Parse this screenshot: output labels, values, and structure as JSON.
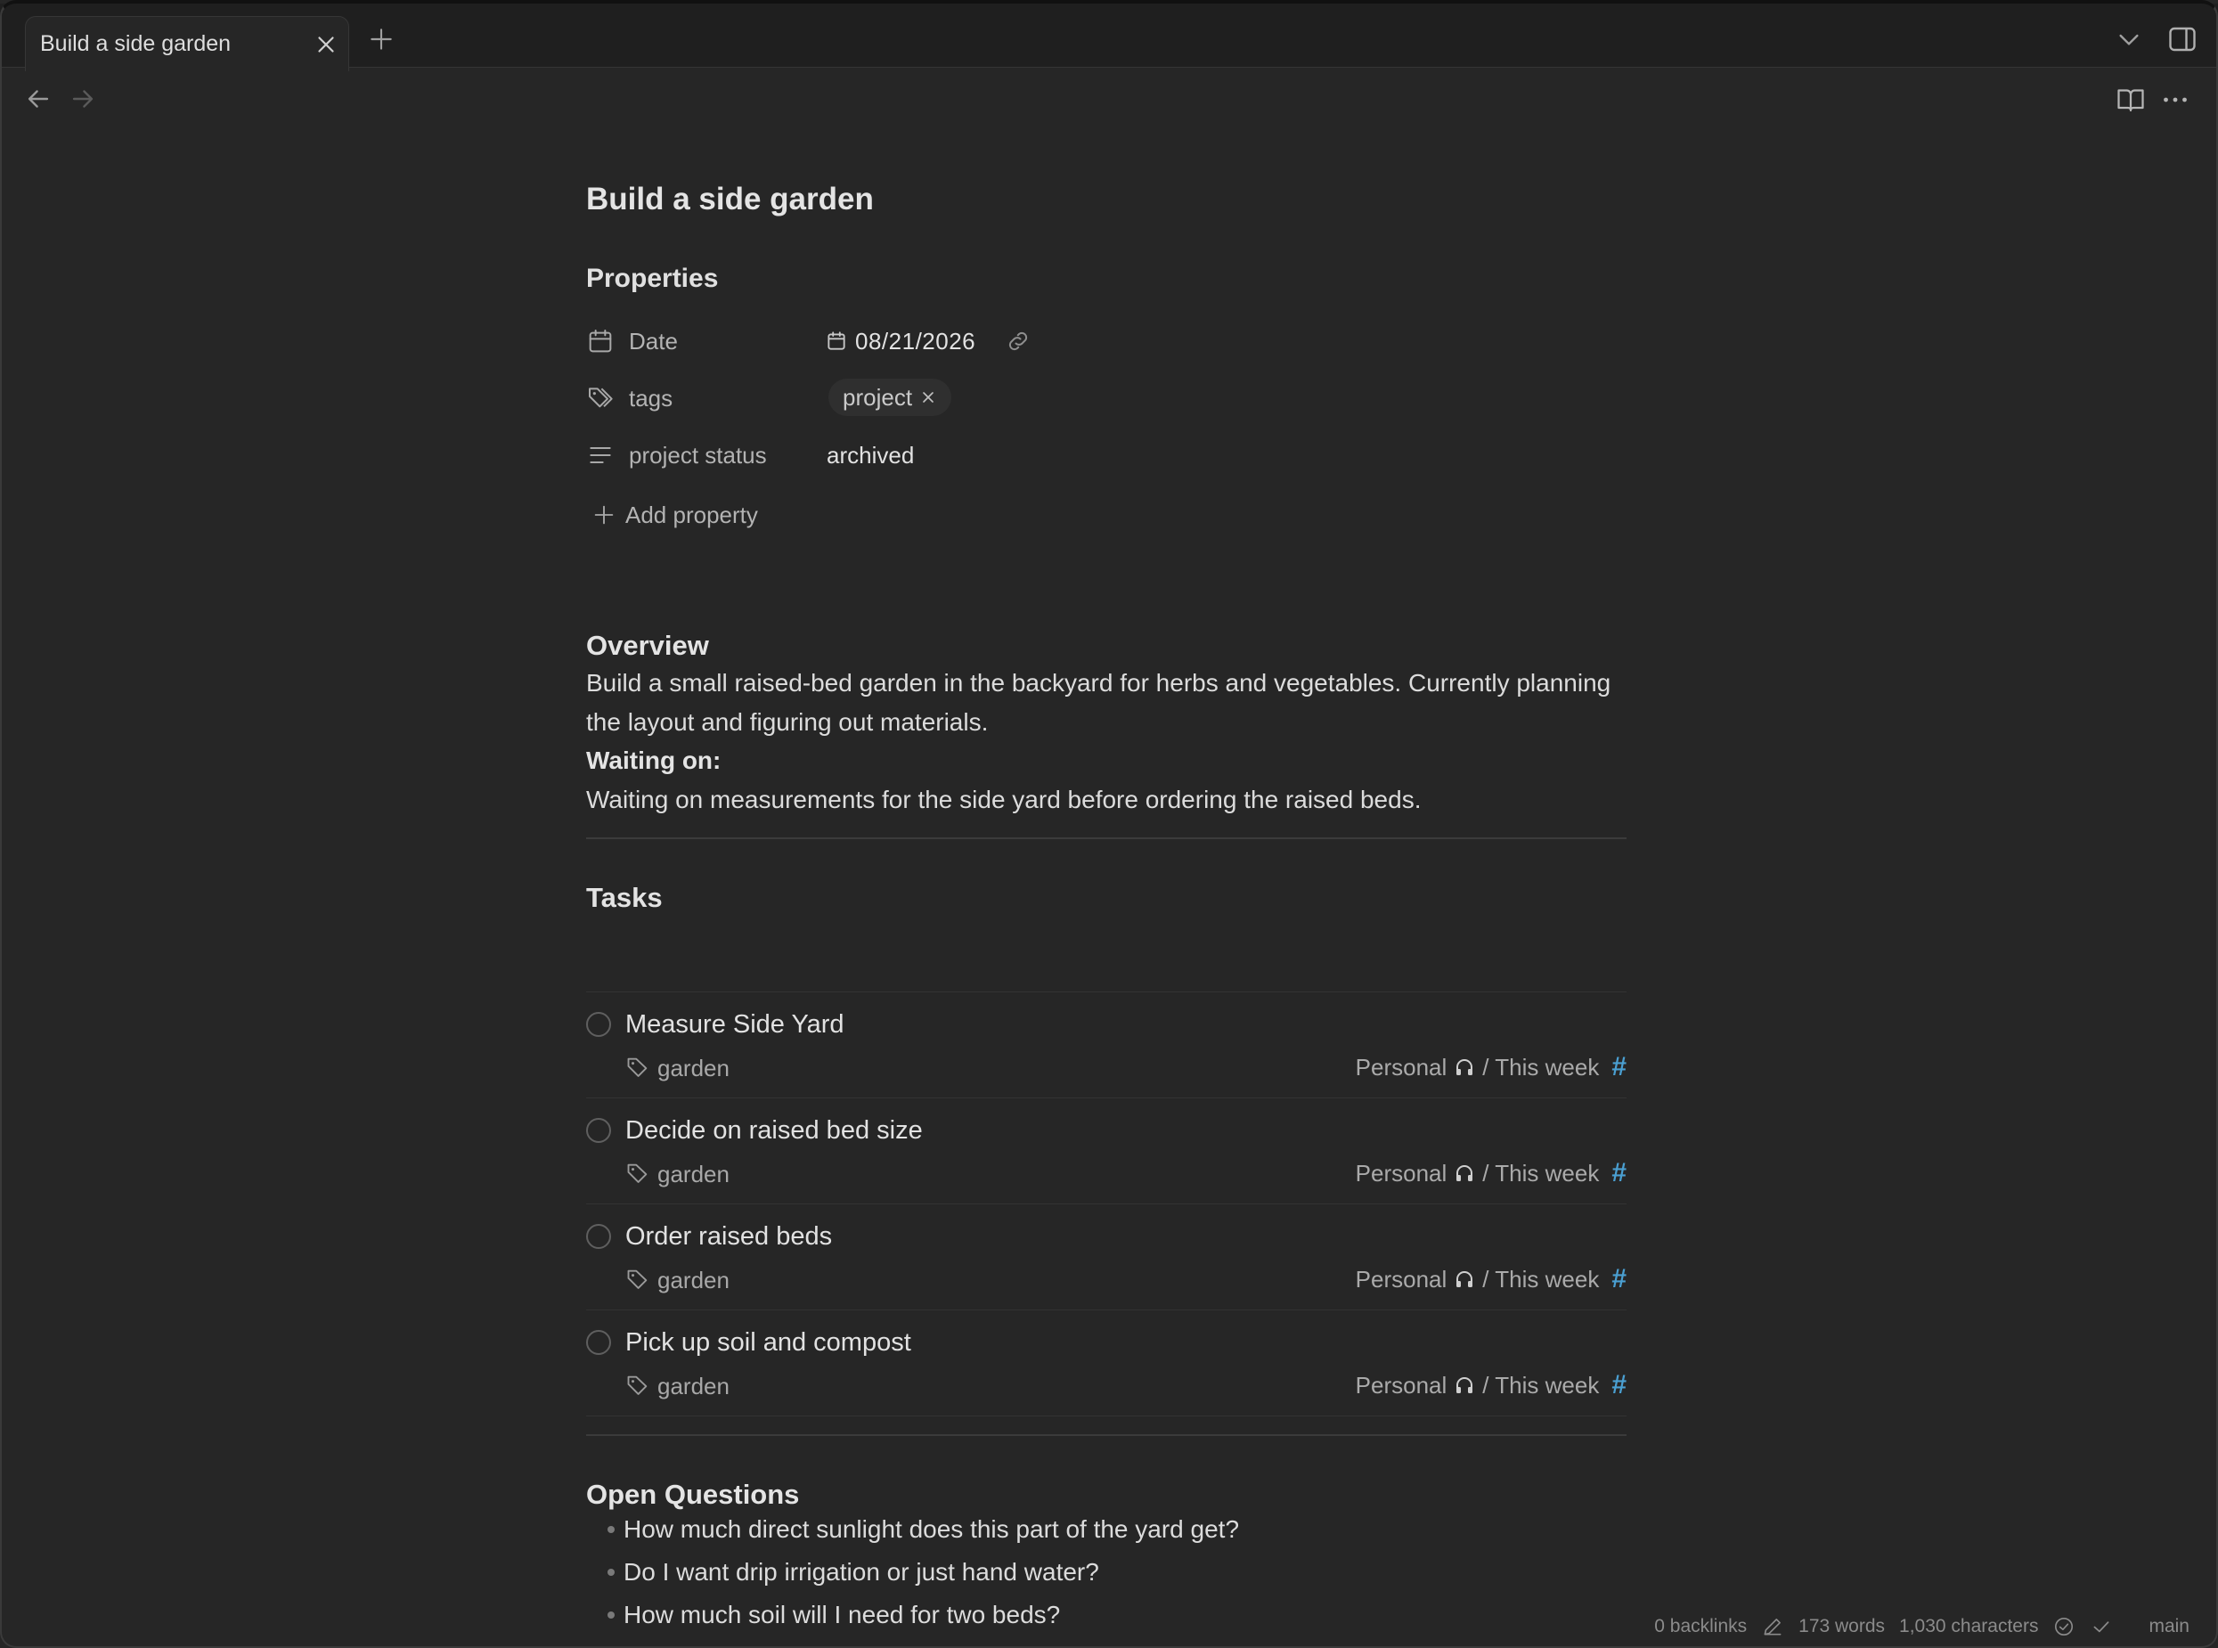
{
  "tab": {
    "title": "Build a side garden"
  },
  "note": {
    "title": "Build a side garden"
  },
  "properties": {
    "heading": "Properties",
    "date": {
      "key": "Date",
      "value": "08/21/2026"
    },
    "tags": {
      "key": "tags",
      "values": [
        "project"
      ]
    },
    "status": {
      "key": "project status",
      "value": "archived"
    },
    "add_label": "Add property"
  },
  "overview": {
    "heading": "Overview",
    "text": "Build a small raised-bed garden in the backyard for herbs and vegetables. Currently planning the layout and figuring out materials.",
    "waiting_label": "Waiting on:",
    "waiting_text": "Waiting on measurements for the side yard before ordering the raised beds."
  },
  "tasks": {
    "heading": "Tasks",
    "items": [
      {
        "title": "Measure Side Yard",
        "tag": "garden",
        "area": "Personal",
        "list": "/ This week",
        "hash": "#"
      },
      {
        "title": "Decide on raised bed size",
        "tag": "garden",
        "area": "Personal",
        "list": "/ This week",
        "hash": "#"
      },
      {
        "title": "Order raised beds",
        "tag": "garden",
        "area": "Personal",
        "list": "/ This week",
        "hash": "#"
      },
      {
        "title": "Pick up soil and compost",
        "tag": "garden",
        "area": "Personal",
        "list": "/ This week",
        "hash": "#"
      }
    ]
  },
  "questions": {
    "heading": "Open Questions",
    "items": [
      "How much direct sunlight does this part of the yard get?",
      "Do I want drip irrigation or just hand water?",
      "How much soil will I need for two beds?"
    ]
  },
  "status_bar": {
    "backlinks": "0 backlinks",
    "words": "173 words",
    "characters": "1,030 characters",
    "branch": "main"
  },
  "icons": {
    "tab_close": "close-icon",
    "new_tab": "plus-icon",
    "tab_list": "chevron-down-icon",
    "sidebar": "sidebar-toggle-icon",
    "back": "arrow-left-icon",
    "forward": "arrow-right-icon",
    "reading": "book-icon",
    "more": "more-horizontal-icon",
    "task_area": "headphones-icon"
  },
  "colors": {
    "background": "#262626",
    "tab_strip": "#1f1f1f",
    "accent": "#4a9fd1"
  }
}
